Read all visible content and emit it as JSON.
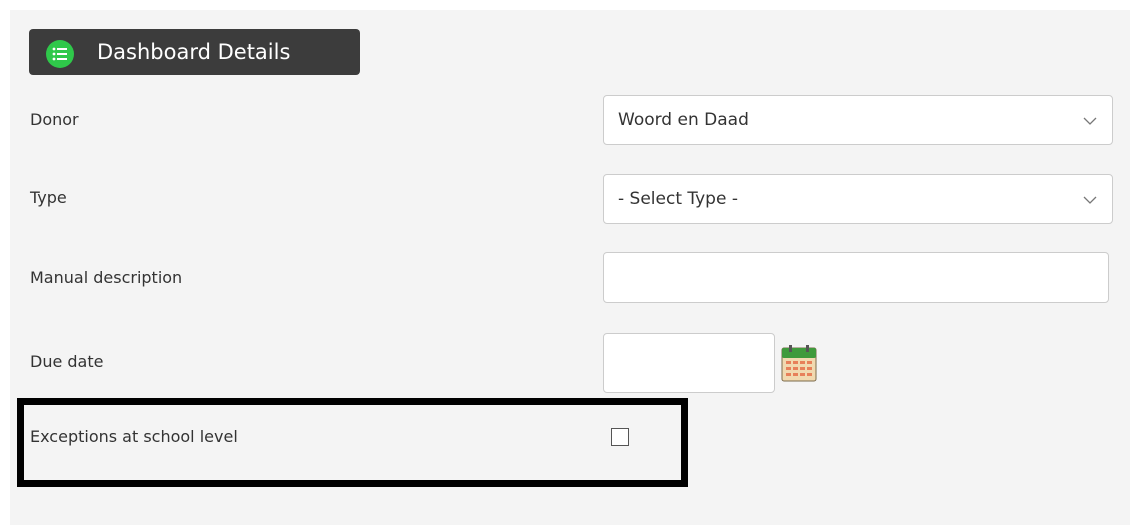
{
  "header": {
    "title": "Dashboard Details",
    "icon": "list-icon",
    "icon_color": "#2fc84a",
    "background": "#3c3c3c"
  },
  "form": {
    "donor": {
      "label": "Donor",
      "value": "Woord en Daad"
    },
    "type": {
      "label": "Type",
      "value": "- Select Type -"
    },
    "manual_description": {
      "label": "Manual description",
      "value": ""
    },
    "due_date": {
      "label": "Due date",
      "value": "",
      "icon": "calendar-icon"
    },
    "exceptions": {
      "label": "Exceptions at school level",
      "checked": false
    }
  }
}
